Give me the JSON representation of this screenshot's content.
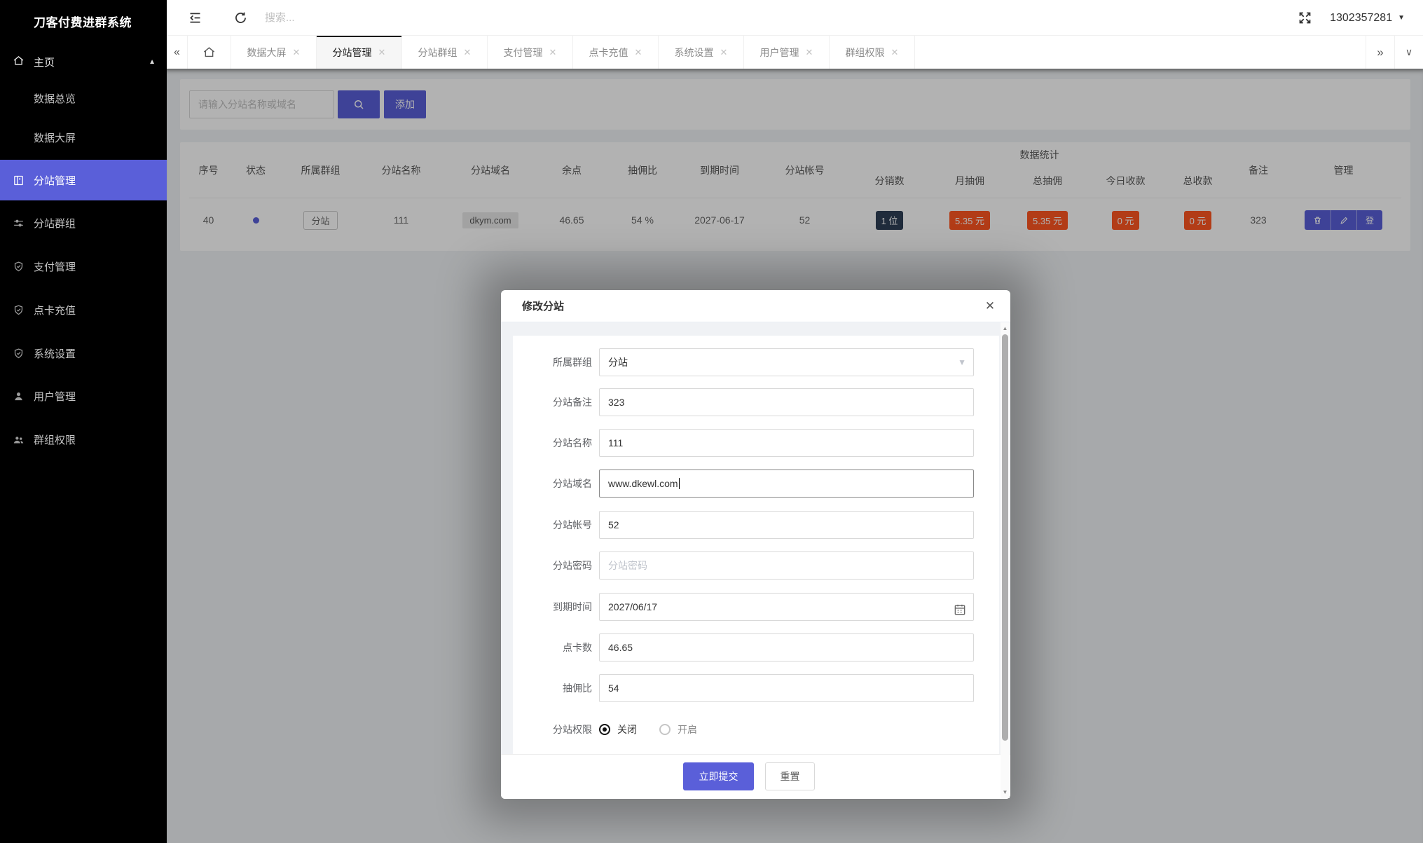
{
  "app": {
    "title": "刀客付费进群系统"
  },
  "topbar": {
    "search_placeholder": "搜索...",
    "username": "1302357281"
  },
  "sidebar": {
    "home_label": "主页",
    "sub_items": [
      {
        "label": "数据总览"
      },
      {
        "label": "数据大屏"
      }
    ],
    "items": [
      {
        "label": "分站管理",
        "icon": "book-icon"
      },
      {
        "label": "分站群组",
        "icon": "sliders-icon"
      },
      {
        "label": "支付管理",
        "icon": "shield-check-icon"
      },
      {
        "label": "点卡充值",
        "icon": "shield-check-icon"
      },
      {
        "label": "系统设置",
        "icon": "shield-check-icon"
      },
      {
        "label": "用户管理",
        "icon": "user-icon"
      },
      {
        "label": "群组权限",
        "icon": "users-icon"
      }
    ]
  },
  "tabs": [
    {
      "label": "数据大屏"
    },
    {
      "label": "分站管理",
      "active": true
    },
    {
      "label": "分站群组"
    },
    {
      "label": "支付管理"
    },
    {
      "label": "点卡充值"
    },
    {
      "label": "系统设置"
    },
    {
      "label": "用户管理"
    },
    {
      "label": "群组权限"
    }
  ],
  "toolbar": {
    "search_placeholder": "请输入分站名称或域名",
    "add_label": "添加"
  },
  "table": {
    "headers": {
      "seq": "序号",
      "status": "状态",
      "group": "所属群组",
      "name": "分站名称",
      "domain": "分站域名",
      "points": "余点",
      "rate": "抽佣比",
      "expire": "到期时间",
      "account": "分站帐号",
      "stats_group": "数据统计",
      "distributors": "分销数",
      "month_commission": "月抽佣",
      "total_commission": "总抽佣",
      "today_income": "今日收款",
      "total_income": "总收款",
      "remark": "备注",
      "manage": "管理"
    },
    "row": {
      "seq": "40",
      "group": "分站",
      "name": "111",
      "domain": "dkym.com",
      "points": "46.65",
      "rate": "54 %",
      "expire": "2027-06-17",
      "account": "52",
      "distributors": "1 位",
      "month_commission": "5.35 元",
      "total_commission": "5.35 元",
      "today_income": "0 元",
      "total_income": "0 元",
      "remark": "323",
      "login_label": "登"
    }
  },
  "modal": {
    "title": "修改分站",
    "close_label": "✕",
    "fields": {
      "group": {
        "label": "所属群组",
        "value": "分站"
      },
      "remark": {
        "label": "分站备注",
        "value": "323"
      },
      "name": {
        "label": "分站名称",
        "value": "111"
      },
      "domain": {
        "label": "分站域名",
        "value": "www.dkewl.com"
      },
      "account": {
        "label": "分站帐号",
        "value": "52"
      },
      "password": {
        "label": "分站密码",
        "placeholder": "分站密码"
      },
      "expire": {
        "label": "到期时间",
        "value": "2027/06/17"
      },
      "points": {
        "label": "点卡数",
        "value": "46.65"
      },
      "rate": {
        "label": "抽佣比",
        "value": "54"
      },
      "perm": {
        "label": "分站权限",
        "off": "关闭",
        "on": "开启"
      }
    },
    "submit_label": "立即提交",
    "reset_label": "重置"
  },
  "colors": {
    "accent": "#5a5fd9",
    "badge_red": "#ff5722",
    "badge_dark": "#2f4056"
  }
}
